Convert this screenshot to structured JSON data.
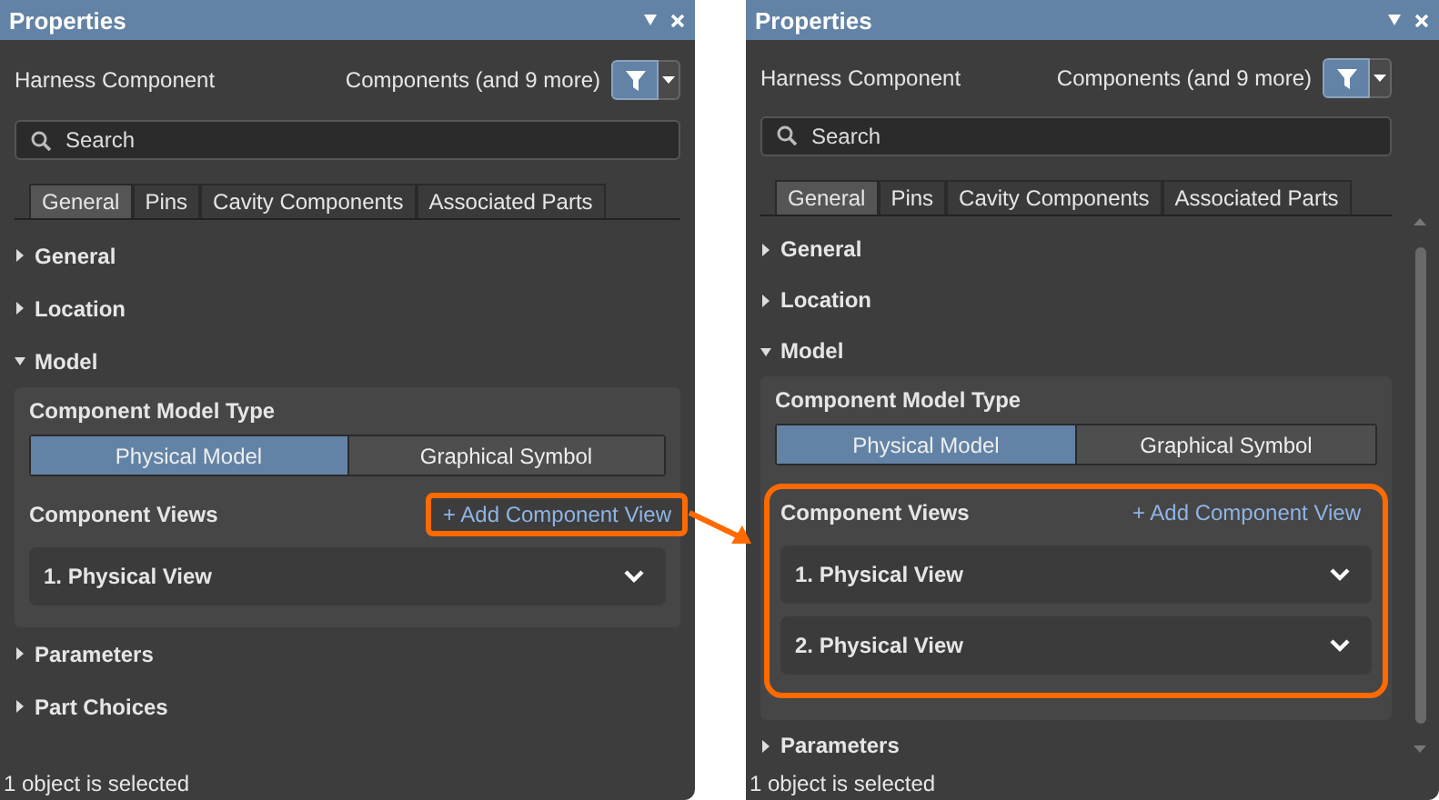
{
  "panels": [
    {
      "title": "Properties",
      "object_type": "Harness Component",
      "filter_label": "Components (and 9 more)",
      "search": {
        "placeholder": "Search"
      },
      "tabs": [
        {
          "label": "General",
          "selected": true
        },
        {
          "label": "Pins",
          "selected": false
        },
        {
          "label": "Cavity Components",
          "selected": false
        },
        {
          "label": "Associated Parts",
          "selected": false
        }
      ],
      "scrollbar": false,
      "link_highlighted": true,
      "views_highlighted": false,
      "sections": [
        {
          "label": "General",
          "expanded": false
        },
        {
          "label": "Location",
          "expanded": false
        },
        {
          "label": "Model",
          "expanded": true
        },
        {
          "label": "Parameters",
          "expanded": false
        },
        {
          "label": "Part Choices",
          "expanded": false
        }
      ],
      "model": {
        "type_label": "Component Model Type",
        "types": [
          {
            "label": "Physical Model",
            "selected": true
          },
          {
            "label": "Graphical Symbol",
            "selected": false
          }
        ],
        "views_label": "Component Views",
        "add_link": "+ Add Component View",
        "views": [
          "1. Physical View"
        ]
      },
      "status": "1 object is selected"
    },
    {
      "title": "Properties",
      "object_type": "Harness Component",
      "filter_label": "Components (and 9 more)",
      "search": {
        "placeholder": "Search"
      },
      "tabs": [
        {
          "label": "General",
          "selected": true
        },
        {
          "label": "Pins",
          "selected": false
        },
        {
          "label": "Cavity Components",
          "selected": false
        },
        {
          "label": "Associated Parts",
          "selected": false
        }
      ],
      "scrollbar": true,
      "link_highlighted": false,
      "views_highlighted": true,
      "sections": [
        {
          "label": "General",
          "expanded": false
        },
        {
          "label": "Location",
          "expanded": false
        },
        {
          "label": "Model",
          "expanded": true
        },
        {
          "label": "Parameters",
          "expanded": false
        }
      ],
      "model": {
        "type_label": "Component Model Type",
        "types": [
          {
            "label": "Physical Model",
            "selected": true
          },
          {
            "label": "Graphical Symbol",
            "selected": false
          }
        ],
        "views_label": "Component Views",
        "add_link": "+ Add Component View",
        "views": [
          "1. Physical View",
          "2. Physical View"
        ]
      },
      "status": "1 object is selected"
    }
  ]
}
